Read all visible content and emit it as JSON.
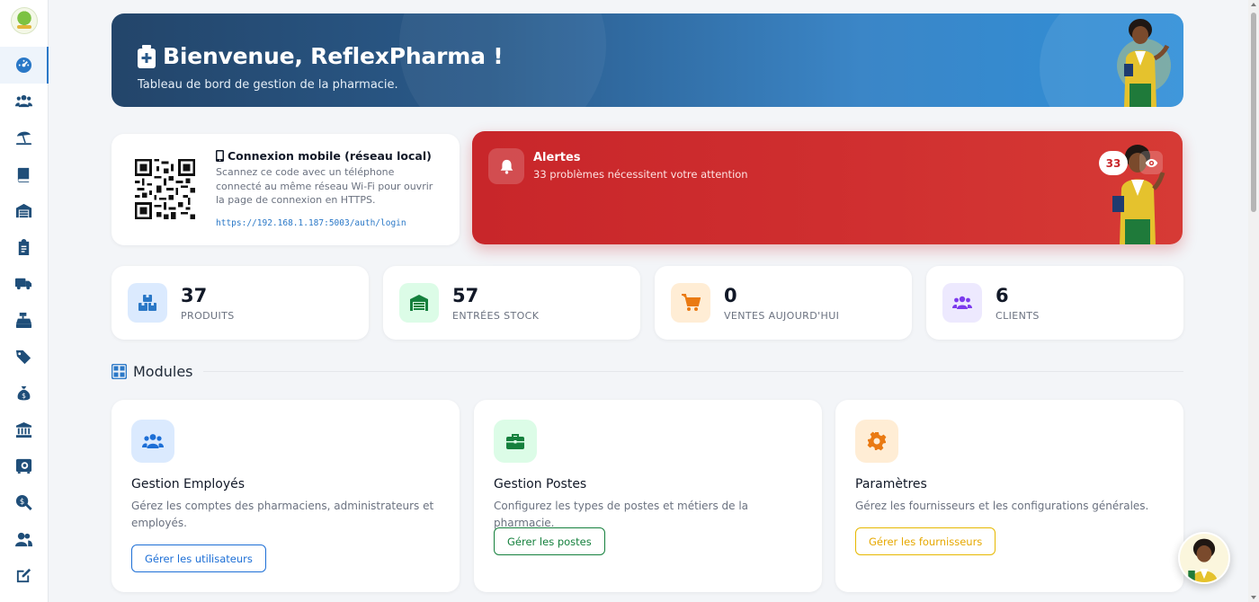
{
  "sidebar": {
    "items": [
      {
        "name": "tachometer-icon",
        "active": true
      },
      {
        "name": "users-icon"
      },
      {
        "name": "umbrella-beach-icon"
      },
      {
        "name": "book-icon"
      },
      {
        "name": "warehouse-icon"
      },
      {
        "name": "clipboard-icon"
      },
      {
        "name": "truck-icon"
      },
      {
        "name": "cash-register-icon"
      },
      {
        "name": "tags-icon"
      },
      {
        "name": "money-bag-icon"
      },
      {
        "name": "bank-icon"
      },
      {
        "name": "safe-icon"
      },
      {
        "name": "search-dollar-icon"
      },
      {
        "name": "user-group-icon"
      },
      {
        "name": "edit-icon"
      }
    ]
  },
  "hero": {
    "title": "Bienvenue, ReflexPharma !",
    "subtitle": "Tableau de bord de gestion de la pharmacie."
  },
  "mobile": {
    "title": "Connexion mobile (réseau local)",
    "description": "Scannez ce code avec un téléphone connecté au même réseau Wi-Fi pour ouvrir la page de connexion en HTTPS.",
    "url": "https://192.168.1.187:5003/auth/login"
  },
  "alert": {
    "title": "Alertes",
    "message": "33 problèmes nécessitent votre attention",
    "count": "33"
  },
  "stats": [
    {
      "value": "37",
      "label": "PRODUITS",
      "icon": "boxes-icon",
      "color": "#2a78c7",
      "bg": "#dbeafe"
    },
    {
      "value": "57",
      "label": "ENTRÉES STOCK",
      "icon": "warehouse-icon",
      "color": "#15803d",
      "bg": "#dcfce7"
    },
    {
      "value": "0",
      "label": "VENTES AUJOURD'HUI",
      "icon": "cart-icon",
      "color": "#ea7a12",
      "bg": "#ffedd5"
    },
    {
      "value": "6",
      "label": "CLIENTS",
      "icon": "users-icon",
      "color": "#7c3aed",
      "bg": "#ede9fe"
    }
  ],
  "modules_section": {
    "title": "Modules"
  },
  "modules": [
    {
      "title": "Gestion Employés",
      "description": "Gérez les comptes des pharmaciens, administrateurs et employés.",
      "button": "Gérer les utilisateurs",
      "icon": "users-icon",
      "color": "#1d6fd6",
      "bg": "#dbeafe"
    },
    {
      "title": "Gestion Postes",
      "description": "Configurez les types de postes et métiers de la pharmacie.",
      "button": "Gérer les postes",
      "icon": "briefcase-icon",
      "color": "#15803d",
      "bg": "#dcfce7"
    },
    {
      "title": "Paramètres",
      "description": "Gérez les fournisseurs et les configurations générales.",
      "button": "Gérer les fournisseurs",
      "icon": "gear-icon",
      "color": "#ea7a12",
      "bg": "#ffedd5",
      "button_color": "#e6b800"
    }
  ]
}
